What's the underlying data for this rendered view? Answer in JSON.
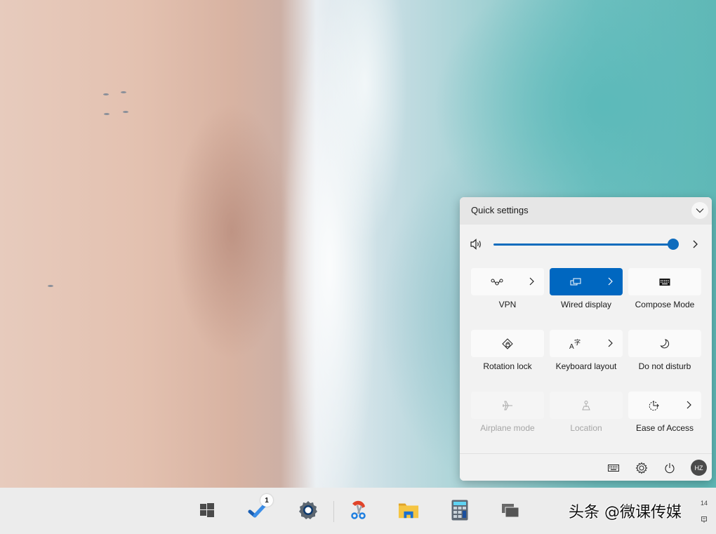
{
  "desktop": {
    "wallpaper": "aerial beach with waves"
  },
  "quick_settings": {
    "title": "Quick settings",
    "collapse_icon": "chevron-down-icon",
    "volume": {
      "icon": "speaker-icon",
      "level_percent": 100,
      "more_icon": "chevron-right-icon"
    },
    "tiles": [
      {
        "label": "VPN",
        "icon": "vpn-icon",
        "state": "off",
        "has_more": true
      },
      {
        "label": "Wired display",
        "icon": "wired-display-icon",
        "state": "on",
        "has_more": true
      },
      {
        "label": "Compose Mode",
        "icon": "keyboard-icon",
        "state": "off",
        "has_more": false
      },
      {
        "label": "Rotation lock",
        "icon": "rotation-lock-icon",
        "state": "off",
        "has_more": false
      },
      {
        "label": "Keyboard layout",
        "icon": "language-icon",
        "state": "off",
        "has_more": true
      },
      {
        "label": "Do not disturb",
        "icon": "moon-icon",
        "state": "off",
        "has_more": false
      },
      {
        "label": "Airplane mode",
        "icon": "airplane-icon",
        "state": "disabled",
        "has_more": false
      },
      {
        "label": "Location",
        "icon": "location-icon",
        "state": "disabled",
        "has_more": false
      },
      {
        "label": "Ease of Access",
        "icon": "accessibility-icon",
        "state": "off",
        "has_more": true
      }
    ],
    "footer": {
      "keyboard_icon": "keyboard-icon",
      "settings_icon": "gear-icon",
      "power_icon": "power-icon",
      "avatar_initials": "HZ"
    },
    "colors": {
      "accent": "#0067c0",
      "panel_bg": "#f2f2f2",
      "header_bg": "#e6e6e6"
    }
  },
  "taskbar": {
    "items": [
      {
        "name": "Start",
        "icon": "windows-icon"
      },
      {
        "name": "To Do",
        "icon": "checkmark-icon",
        "badge": "1"
      },
      {
        "name": "Settings",
        "icon": "gear-icon"
      },
      {
        "name": "Snipping Tool",
        "icon": "scissors-icon"
      },
      {
        "name": "File Explorer",
        "icon": "folder-icon"
      },
      {
        "name": "Calculator",
        "icon": "calculator-icon"
      },
      {
        "name": "Task View",
        "icon": "task-view-icon"
      }
    ],
    "watermark": "头条 @微课传媒",
    "clock_fragment": "14"
  }
}
